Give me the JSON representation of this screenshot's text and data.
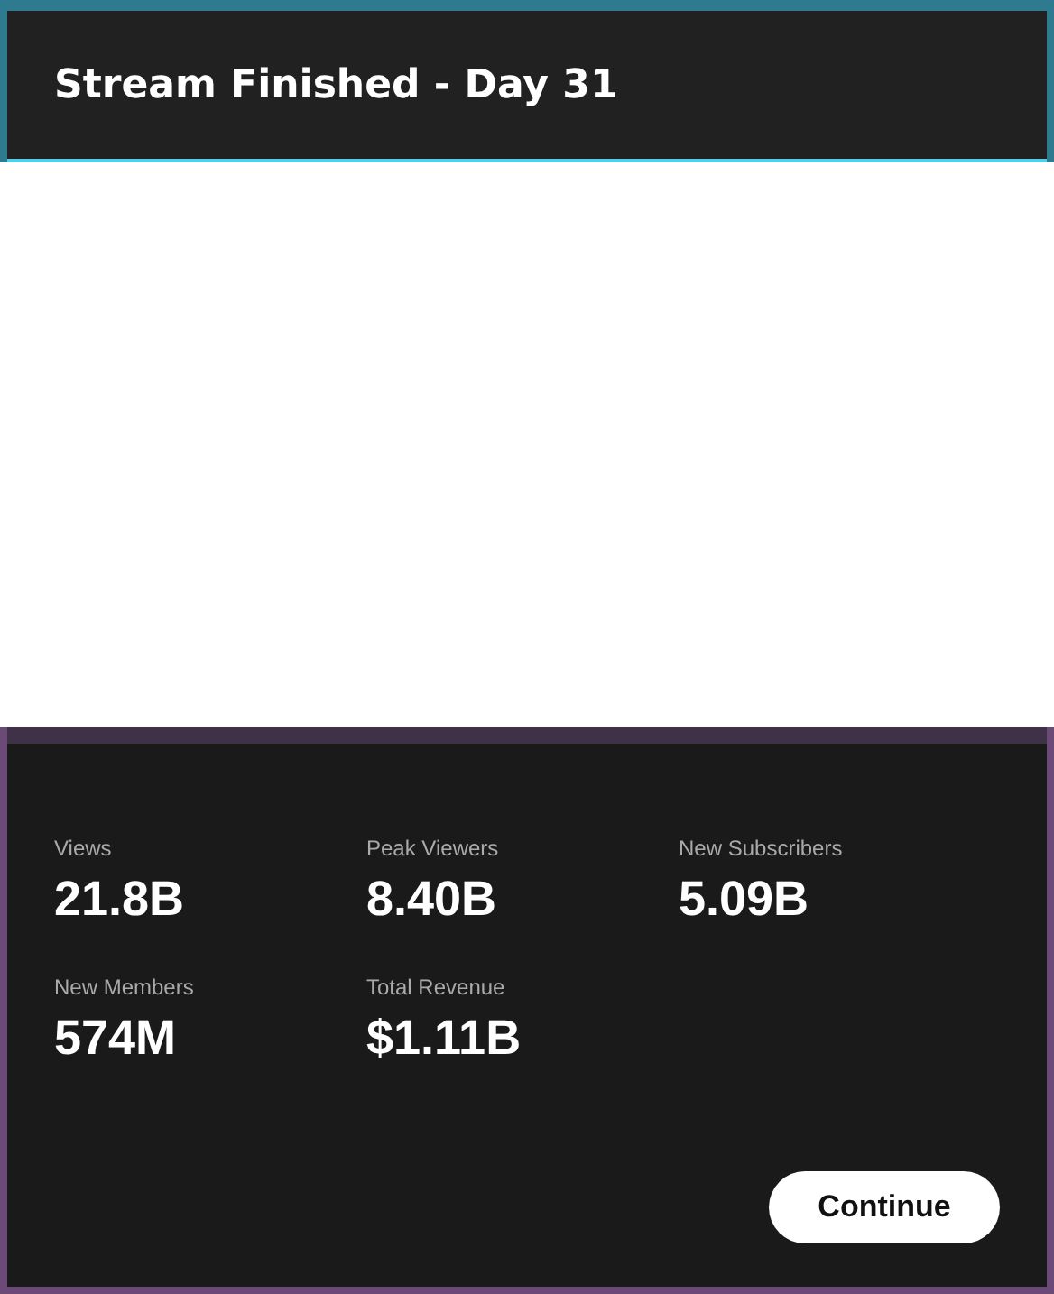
{
  "dialog": {
    "title": "Stream Finished - Day 31"
  },
  "stats": [
    {
      "label": "Views",
      "value": "21.8B"
    },
    {
      "label": "Peak Viewers",
      "value": "8.40B"
    },
    {
      "label": "New Subscribers",
      "value": "5.09B"
    },
    {
      "label": "New Members",
      "value": "574M"
    },
    {
      "label": "Total Revenue",
      "value": "$1.11B"
    }
  ],
  "buttons": [
    "Continue"
  ]
}
